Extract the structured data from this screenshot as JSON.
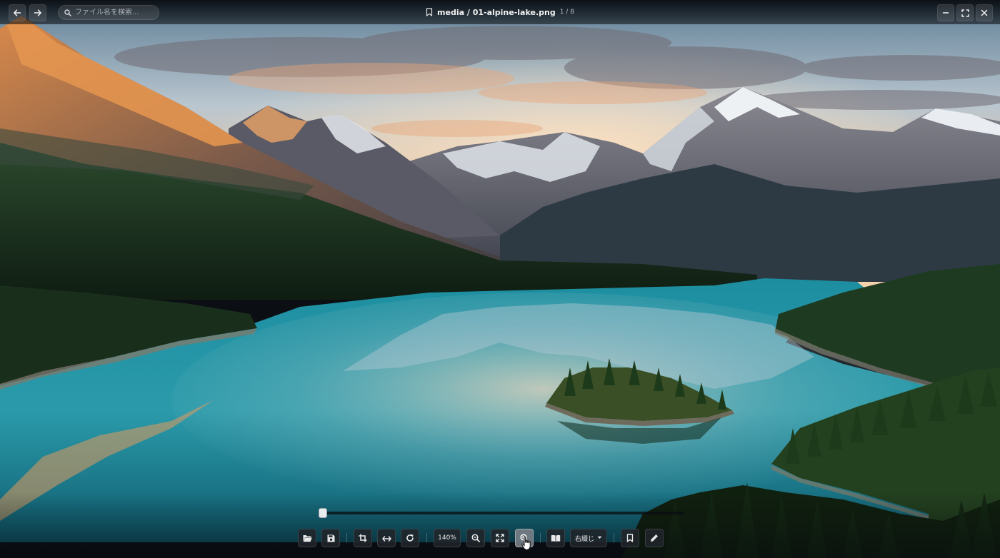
{
  "window": {
    "breadcrumb": "media / 01-alpine-lake.png",
    "page_indicator": "1 / 8"
  },
  "search": {
    "placeholder": "ファイル名を検索..."
  },
  "nav": {
    "back_icon": "arrow-left-icon",
    "forward_icon": "arrow-right-icon"
  },
  "window_controls": {
    "minimize_icon": "minimize-icon",
    "maximize_icon": "fullscreen-icon",
    "close_icon": "close-icon"
  },
  "timeline": {
    "position_percent": 0
  },
  "toolbar": {
    "zoom_label": "140%",
    "reading_direction": "右綴じ",
    "icons": [
      "folder-open-icon",
      "save-icon",
      "crop-icon",
      "flip-horizontal-icon",
      "rotate-icon",
      "zoom-out-icon",
      "fit-screen-icon",
      "zoom-in-icon",
      "book-icon",
      "bookmark-icon",
      "pencil-icon"
    ],
    "active_tool": "zoom-in-icon"
  },
  "colors": {
    "sky_top": "#8fb0c6",
    "sky_glow": "#f4b27a",
    "lake": "#1e8fa0",
    "forest": "#1f3a22"
  }
}
